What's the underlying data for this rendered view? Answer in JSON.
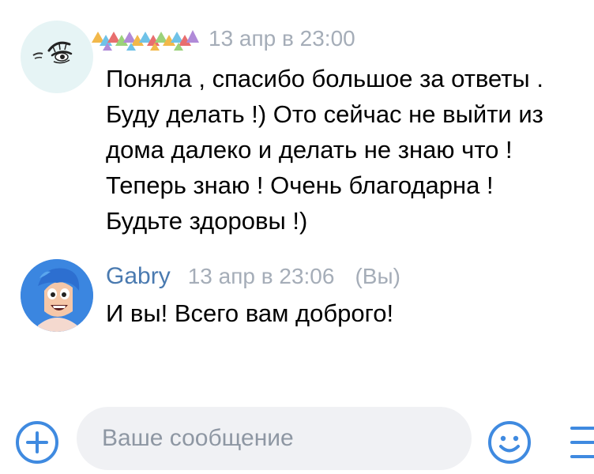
{
  "messages": [
    {
      "sender": "",
      "time": "13 апр в 23:00",
      "you": "",
      "lines": [
        "Поняла , спасибо большое за ответы .",
        "Буду делать !) Ото сейчас не выйти из",
        "дома далеко и делать не знаю что !",
        "Теперь знаю ! Очень благодарна !",
        "Будьте здоровы !)"
      ],
      "avatar_icon": "drawn-eye-avatar-icon"
    },
    {
      "sender": "Gabry",
      "time": "13 апр в 23:06",
      "you": "(Вы)",
      "lines": [
        "И вы! Всего вам доброго!"
      ],
      "avatar_icon": "cartoon-character-avatar-icon"
    }
  ],
  "composer": {
    "placeholder": "Ваше сообщение",
    "attach_icon": "plus-circle-icon",
    "emoji_icon": "smiley-icon",
    "menu_icon": "menu-icon"
  },
  "colors": {
    "accent": "#3f8ae0",
    "sender_name": "#4a7ab0",
    "meta_text": "#a5adb8",
    "input_background": "#f0f1f4"
  }
}
